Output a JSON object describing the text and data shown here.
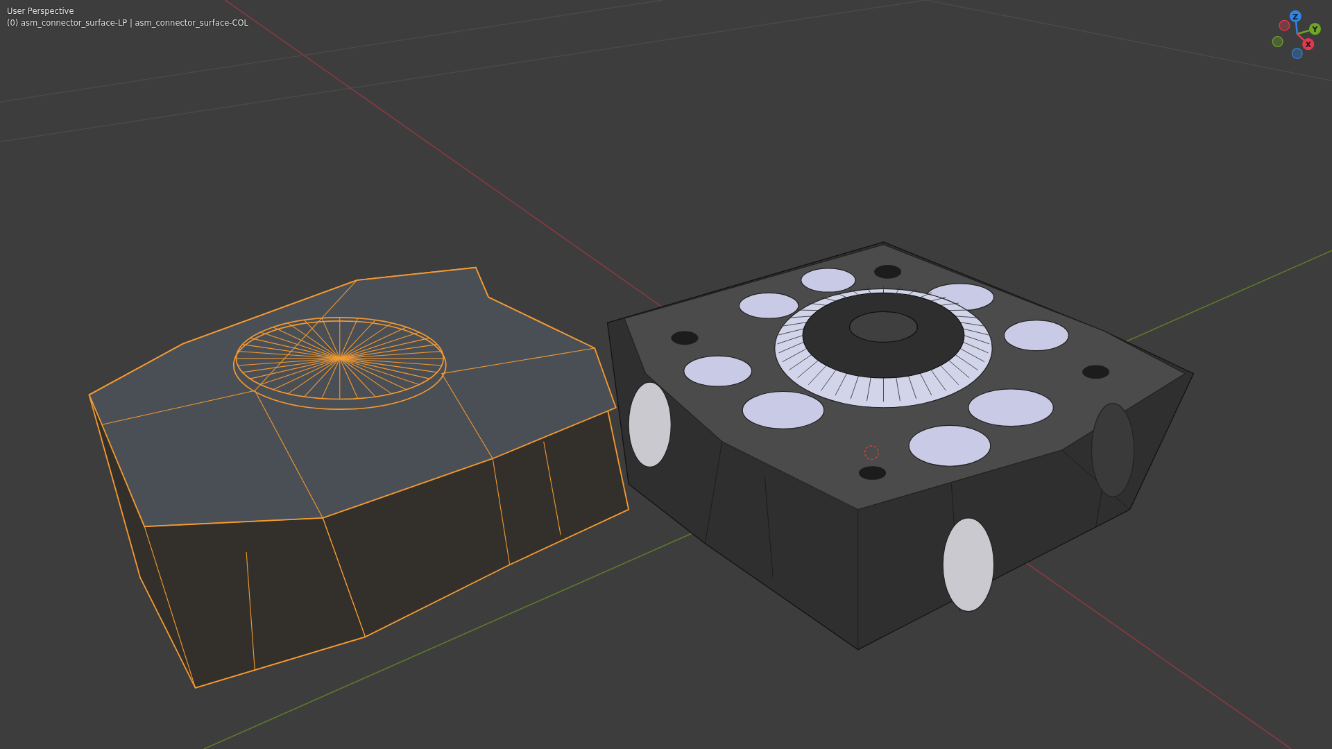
{
  "viewport": {
    "view_name": "User Perspective",
    "object_info": "(0) asm_connector_surface-LP | asm_connector_surface-COL"
  },
  "gizmo": {
    "axes": [
      {
        "label": "Z",
        "color": "#2f84e6"
      },
      {
        "label": "Y",
        "color": "#6fa624"
      },
      {
        "label": "X",
        "color": "#e5384e"
      }
    ]
  }
}
